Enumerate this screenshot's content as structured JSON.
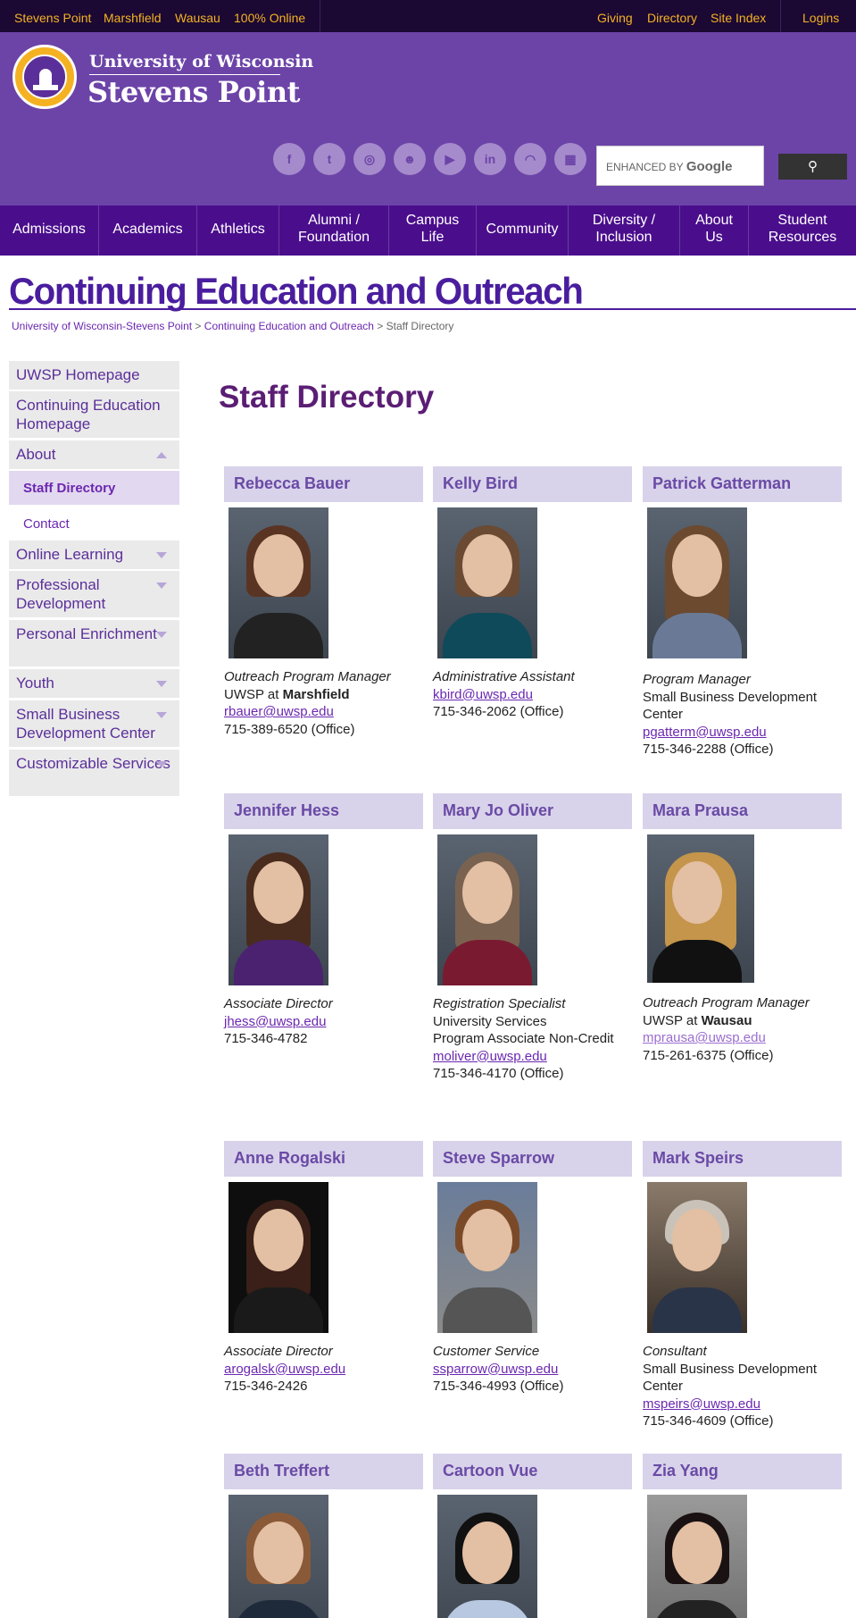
{
  "topbar": {
    "left_links": [
      "Stevens Point",
      "Marshfield",
      "Wausau",
      "100% Online"
    ],
    "right_links": [
      "Giving",
      "Directory",
      "Site Index"
    ],
    "logins": "Logins"
  },
  "brand": {
    "line1": "University of Wisconsin",
    "line2": "Stevens Point"
  },
  "social_icons": [
    "facebook-icon",
    "twitter-icon",
    "instagram-icon",
    "snapchat-icon",
    "youtube-icon",
    "linkedin-icon",
    "rss-icon",
    "calendar-icon"
  ],
  "search": {
    "placeholder_prefix": "ENHANCED BY",
    "placeholder_brand": "Google"
  },
  "nav": [
    "Admissions",
    "Academics",
    "Athletics",
    "Alumni /\nFoundation",
    "Campus\nLife",
    "Community",
    "Diversity /\nInclusion",
    "About\nUs",
    "Student\nResources"
  ],
  "page_title": "Continuing Education and Outreach",
  "breadcrumb": {
    "home": "University of Wisconsin-Stevens Point",
    "section": "Continuing Education and Outreach",
    "current": "Staff Directory",
    "sep": ">"
  },
  "sidebar": [
    {
      "label": "UWSP Homepage"
    },
    {
      "label": "Continuing Education Homepage"
    },
    {
      "label": "About"
    },
    {
      "label": "Staff Directory"
    },
    {
      "label": "Contact"
    },
    {
      "label": "Online Learning"
    },
    {
      "label": "Professional Development"
    },
    {
      "label": "Personal Enrichment"
    },
    {
      "label": "Youth"
    },
    {
      "label": "Small Business Development Center"
    },
    {
      "label": "Customizable Services"
    }
  ],
  "heading": "Staff Directory",
  "staff": [
    {
      "name": "Rebecca Bauer",
      "title": "Outreach Program Manager",
      "unit_prefix": "UWSP at ",
      "unit_bold": "Marshfield",
      "email": "rbauer@uwsp.edu",
      "phone": "715-389-6520 (Office)"
    },
    {
      "name": "Kelly Bird",
      "title": "Administrative Assistant",
      "email": "kbird@uwsp.edu",
      "phone": "715-346-2062 (Office)"
    },
    {
      "name": "Patrick Gatterman",
      "title": "Program Manager",
      "dept": "Small Business Development Center",
      "email": "pgatterm@uwsp.edu",
      "phone": "715-346-2288 (Office)"
    },
    {
      "name": "Jennifer Hess",
      "title": "Associate Director",
      "email": "jhess@uwsp.edu",
      "phone": "715-346-4782"
    },
    {
      "name": "Mary Jo Oliver",
      "title": "Registration Specialist",
      "dept": "University Services",
      "dept2": "Program Associate Non-Credit",
      "email": "moliver@uwsp.edu",
      "phone": "715-346-4170 (Office)"
    },
    {
      "name": "Mara Prausa",
      "title": "Outreach Program Manager",
      "unit_prefix": "UWSP at ",
      "unit_bold": "Wausau",
      "email": "mprausa@uwsp.edu",
      "phone": "715-261-6375 (Office)"
    },
    {
      "name": "Anne Rogalski",
      "title": "Associate Director",
      "email": "arogalsk@uwsp.edu",
      "phone": "715-346-2426"
    },
    {
      "name": "Steve Sparrow",
      "title": "Customer Service",
      "email": "ssparrow@uwsp.edu",
      "phone": "715-346-4993 (Office)"
    },
    {
      "name": "Mark Speirs",
      "title": "Consultant",
      "dept": "Small Business Development Center",
      "email": "mspeirs@uwsp.edu",
      "phone": "715-346-4609 (Office)"
    },
    {
      "name": "Beth Treffert"
    },
    {
      "name": "Cartoon Vue"
    },
    {
      "name": "Zia Yang"
    }
  ],
  "colors": {
    "brand_purple": "#6c44a8",
    "nav_purple": "#4a0e8c",
    "gold": "#f4b223",
    "card_header": "#d8d2ea"
  }
}
